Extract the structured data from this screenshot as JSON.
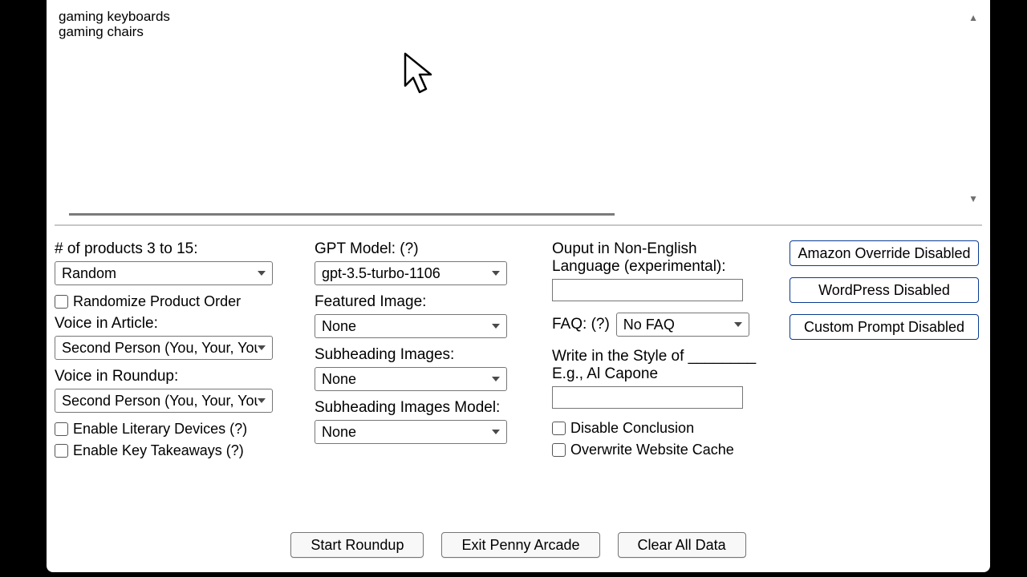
{
  "textarea": {
    "content": "gaming keyboards\ngaming chairs"
  },
  "col1": {
    "products_label": "# of products 3 to 15:",
    "products_value": "Random",
    "randomize_label": "Randomize Product Order",
    "voice_article_label": "Voice in Article:",
    "voice_article_value": "Second Person (You, Your, Yours)",
    "voice_roundup_label": "Voice in Roundup:",
    "voice_roundup_value": "Second Person (You, Your, Yours)",
    "literary_label": "Enable Literary Devices (?)",
    "takeaways_label": "Enable Key Takeaways (?)"
  },
  "col2": {
    "gpt_label": "GPT Model: (?)",
    "gpt_value": "gpt-3.5-turbo-1106",
    "featured_label": "Featured Image:",
    "featured_value": "None",
    "sub_label": "Subheading Images:",
    "sub_value": "None",
    "submodel_label": "Subheading Images Model:",
    "submodel_value": "None"
  },
  "col3": {
    "lang_label": "Ouput in Non-English Language (experimental):",
    "faq_label": "FAQ: (?)",
    "faq_value": "No FAQ",
    "style_label1": "Write in the Style of ________",
    "style_label2": "E.g., Al Capone",
    "disable_concl": "Disable Conclusion",
    "overwrite_cache": "Overwrite Website Cache"
  },
  "col4": {
    "amazon": "Amazon Override Disabled",
    "wordpress": "WordPress Disabled",
    "custom": "Custom Prompt Disabled"
  },
  "bottom": {
    "start": "Start Roundup",
    "exit": "Exit Penny Arcade",
    "clear": "Clear All Data"
  }
}
